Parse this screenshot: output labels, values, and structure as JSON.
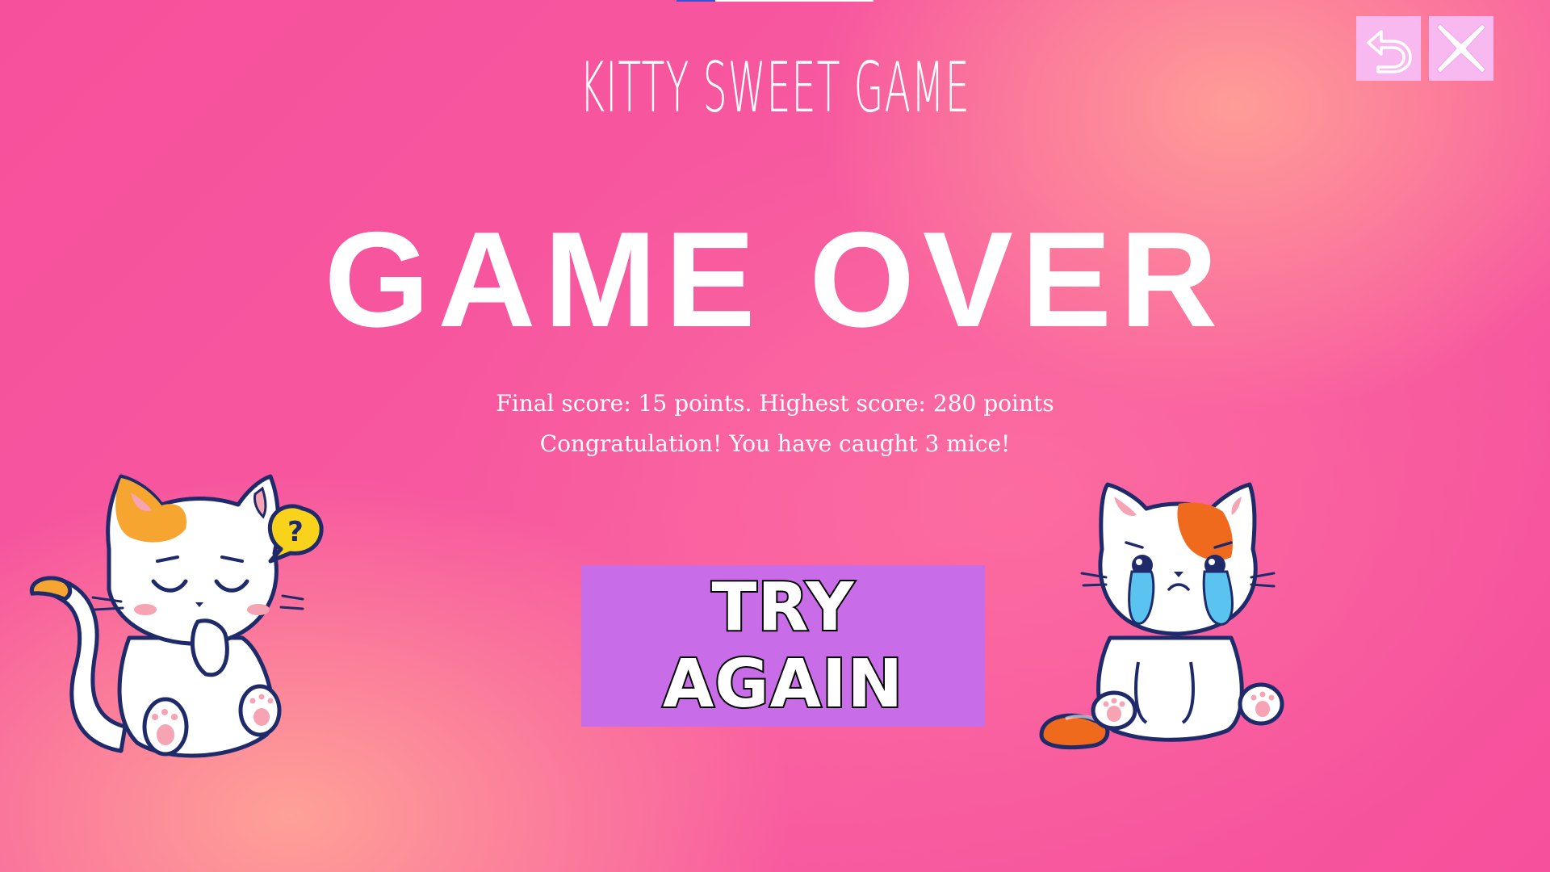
{
  "header": {
    "game_title": "KITTY SWEET GAME"
  },
  "toolbar": {
    "back_icon": "undo-arrow-icon",
    "close_icon": "close-x-icon"
  },
  "game_over": {
    "heading": "GAME OVER",
    "score_text": "Final score: 15 points.  Highest score: 280 points",
    "congrats_text": "Congratulation! You have caught 3 mice!",
    "final_score": 15,
    "highest_score": 280,
    "mice_caught": 3
  },
  "actions": {
    "try_again_label": "TRY AGAIN"
  },
  "question_mark": "?",
  "colors": {
    "background": "#f6509c",
    "button": "#c96ce8",
    "icon_button": "#f8b8f0",
    "text": "#ffffff"
  }
}
